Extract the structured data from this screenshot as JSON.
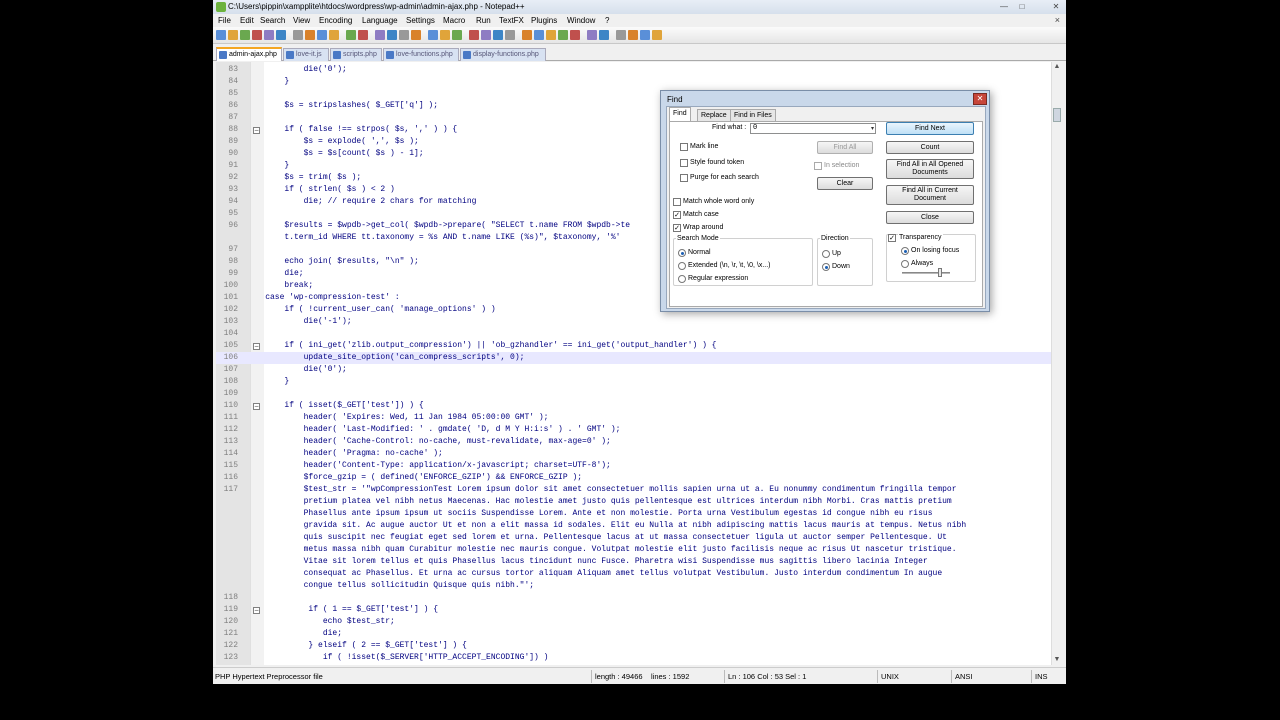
{
  "window": {
    "title": "C:\\Users\\pippin\\xampplite\\htdocs\\wordpress\\wp-admin\\admin-ajax.php - Notepad++",
    "controls": {
      "minimize": "—",
      "maximize": "□",
      "close": "✕"
    }
  },
  "menu": {
    "items": [
      "File",
      "Edit",
      "Search",
      "View",
      "Encoding",
      "Language",
      "Settings",
      "Macro",
      "Run",
      "TextFX",
      "Plugins",
      "Window",
      "?"
    ],
    "close": "×"
  },
  "toolbar": {
    "icons": [
      "new-file",
      "open-file",
      "save",
      "save-all",
      "close",
      "close-all",
      "print",
      "cut",
      "copy",
      "paste",
      "undo",
      "redo",
      "find",
      "replace",
      "zoom-in",
      "zoom-out",
      "sync-vertical",
      "sync-horizontal",
      "word-wrap",
      "show-all-chars",
      "indent-guide",
      "user-define",
      "doc-map",
      "function-list",
      "record-macro",
      "stop-macro",
      "play-macro",
      "play-multiple",
      "save-macro",
      "spell-check",
      "move-up",
      "move-down",
      "compare",
      "clear"
    ]
  },
  "tabs": [
    "admin-ajax.php",
    "love-it.js",
    "scripts.php",
    "love-functions.php",
    "display-functions.php"
  ],
  "active_tab": "admin-ajax.php",
  "editor": {
    "lines": [
      {
        "n": "83",
        "code": "            die('0');"
      },
      {
        "n": "84",
        "code": "        }"
      },
      {
        "n": "85",
        "code": ""
      },
      {
        "n": "86",
        "code": "        $s = stripslashes( $_GET['q'] );"
      },
      {
        "n": "87",
        "code": ""
      },
      {
        "n": "88",
        "code": "        if ( false !== strpos( $s, ',' ) ) {"
      },
      {
        "n": "89",
        "code": "            $s = explode( ',', $s );"
      },
      {
        "n": "90",
        "code": "            $s = $s[count( $s ) - 1];"
      },
      {
        "n": "91",
        "code": "        }"
      },
      {
        "n": "92",
        "code": "        $s = trim( $s );"
      },
      {
        "n": "93",
        "code": "        if ( strlen( $s ) < 2 )"
      },
      {
        "n": "94",
        "code": "            die; // require 2 chars for matching"
      },
      {
        "n": "95",
        "code": ""
      },
      {
        "n": "96",
        "code": "        $results = $wpdb->get_col( $wpdb->prepare( \"SELECT t.name FROM $wpdb->te"
      },
      {
        "n": "",
        "code": "        t.term_id WHERE tt.taxonomy = %s AND t.name LIKE (%s)\", $taxonomy, '%'"
      },
      {
        "n": "97",
        "code": ""
      },
      {
        "n": "98",
        "code": "        echo join( $results, \"\\n\" );"
      },
      {
        "n": "99",
        "code": "        die;"
      },
      {
        "n": "100",
        "code": "        break;"
      },
      {
        "n": "101",
        "code": "    case 'wp-compression-test' :"
      },
      {
        "n": "102",
        "code": "        if ( !current_user_can( 'manage_options' ) )"
      },
      {
        "n": "103",
        "code": "            die('-1');"
      },
      {
        "n": "104",
        "code": ""
      },
      {
        "n": "105",
        "code": "        if ( ini_get('zlib.output_compression') || 'ob_gzhandler' == ini_get('output_handler') ) {"
      },
      {
        "n": "106",
        "code": "            update_site_option('can_compress_scripts', 0);"
      },
      {
        "n": "107",
        "code": "            die('0');"
      },
      {
        "n": "108",
        "code": "        }"
      },
      {
        "n": "109",
        "code": ""
      },
      {
        "n": "110",
        "code": "        if ( isset($_GET['test']) ) {"
      },
      {
        "n": "111",
        "code": "            header( 'Expires: Wed, 11 Jan 1984 05:00:00 GMT' );"
      },
      {
        "n": "112",
        "code": "            header( 'Last-Modified: ' . gmdate( 'D, d M Y H:i:s' ) . ' GMT' );"
      },
      {
        "n": "113",
        "code": "            header( 'Cache-Control: no-cache, must-revalidate, max-age=0' );"
      },
      {
        "n": "114",
        "code": "            header( 'Pragma: no-cache' );"
      },
      {
        "n": "115",
        "code": "            header('Content-Type: application/x-javascript; charset=UTF-8');"
      },
      {
        "n": "116",
        "code": "            $force_gzip = ( defined('ENFORCE_GZIP') && ENFORCE_GZIP );"
      },
      {
        "n": "117",
        "code": "            $test_str = '\"wpCompressionTest Lorem ipsum dolor sit amet consectetuer mollis sapien urna ut a. Eu nonummy condimentum fringilla tempor"
      },
      {
        "n": "",
        "code": "            pretium platea vel nibh netus Maecenas. Hac molestie amet justo quis pellentesque est ultrices interdum nibh Morbi. Cras mattis pretium"
      },
      {
        "n": "",
        "code": "            Phasellus ante ipsum ipsum ut sociis Suspendisse Lorem. Ante et non molestie. Porta urna Vestibulum egestas id congue nibh eu risus"
      },
      {
        "n": "",
        "code": "            gravida sit. Ac augue auctor Ut et non a elit massa id sodales. Elit eu Nulla at nibh adipiscing mattis lacus mauris at tempus. Netus nibh"
      },
      {
        "n": "",
        "code": "            quis suscipit nec feugiat eget sed lorem et urna. Pellentesque lacus at ut massa consectetuer ligula ut auctor semper Pellentesque. Ut"
      },
      {
        "n": "",
        "code": "            metus massa nibh quam Curabitur molestie nec mauris congue. Volutpat molestie elit justo facilisis neque ac risus Ut nascetur tristique."
      },
      {
        "n": "",
        "code": "            Vitae sit lorem tellus et quis Phasellus lacus tincidunt nunc Fusce. Pharetra wisi Suspendisse mus sagittis libero lacinia Integer"
      },
      {
        "n": "",
        "code": "            consequat ac Phasellus. Et urna ac cursus tortor aliquam Aliquam amet tellus volutpat Vestibulum. Justo interdum condimentum In augue"
      },
      {
        "n": "",
        "code": "            congue tellus sollicitudin Quisque quis nibh.\"';"
      },
      {
        "n": "118",
        "code": ""
      },
      {
        "n": "119",
        "code": "             if ( 1 == $_GET['test'] ) {"
      },
      {
        "n": "120",
        "code": "                echo $test_str;"
      },
      {
        "n": "121",
        "code": "                die;"
      },
      {
        "n": "122",
        "code": "             } elseif ( 2 == $_GET['test'] ) {"
      },
      {
        "n": "123",
        "code": "                if ( !isset($_SERVER['HTTP_ACCEPT_ENCODING']) )"
      }
    ]
  },
  "status": {
    "file_type": "PHP Hypertext Preprocessor file",
    "length": "length : 49466",
    "lines": "lines : 1592",
    "position": "Ln : 106    Col : 53    Sel : 1",
    "eol": "UNIX",
    "encoding": "ANSI",
    "mode": "INS"
  },
  "find_dialog": {
    "title": "Find",
    "close": "✕",
    "tabs": [
      "Find",
      "Replace",
      "Find in Files"
    ],
    "find_what_label": "Find what :",
    "find_what_value": "0",
    "combo_arrow": "▾",
    "check_mark": "✓",
    "mark_line": "Mark line",
    "style_found_token": "Style found token",
    "purge": "Purge for each search",
    "find_all": "Find All",
    "in_selection": "In selection",
    "clear": "Clear",
    "match_whole_word": "Match whole word only",
    "match_case": "Match case",
    "wrap_around": "Wrap around",
    "search_mode_label": "Search Mode",
    "mode_normal": "Normal",
    "mode_extended": "Extended (\\n, \\r, \\t, \\0, \\x...)",
    "mode_regex": "Regular expression",
    "direction_label": "Direction",
    "dir_up": "Up",
    "dir_down": "Down",
    "transparency": "Transparency",
    "on_losing_focus": "On losing focus",
    "always": "Always",
    "btn_find_next": "Find Next",
    "btn_count": "Count",
    "btn_find_all_opened": "Find All in All Opened Documents",
    "btn_find_all_current": "Find All in Current Document",
    "btn_close": "Close",
    "checked": {
      "mark_line": false,
      "style_found_token": false,
      "purge": false,
      "in_selection": false,
      "match_whole_word": false,
      "match_case": true,
      "wrap_around": true,
      "transparency": true
    },
    "search_mode": "Normal",
    "direction": "Down",
    "transparency_mode": "On losing focus",
    "transparency_level": 0.8
  }
}
